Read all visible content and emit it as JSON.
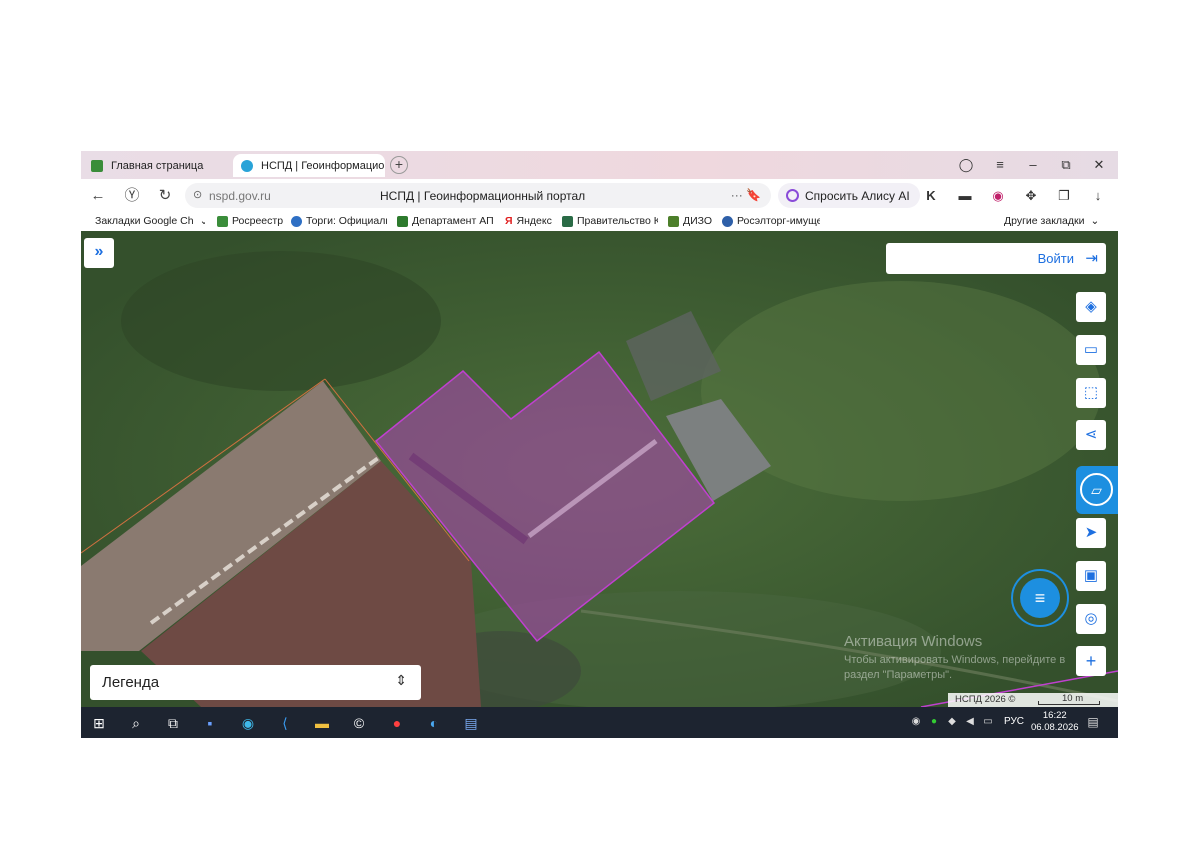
{
  "browser": {
    "tabs": [
      {
        "label": "Главная страница",
        "icon": "gosuslugi-icon",
        "active": false
      },
      {
        "label": "НСПД | Геоинформацио",
        "icon": "nspd-icon",
        "active": true
      }
    ],
    "new_tab": "+",
    "address": "nspd.gov.ru",
    "page_title": "НСПД | Геоинформационный портал",
    "url_more": "··· 🔖",
    "alice_label": "Спросить Алису AI"
  },
  "bookmarks": [
    {
      "label": "Закладки Google Ch",
      "icon": "folder-icon"
    },
    {
      "label": "Росреестр",
      "icon": "rosreestr-icon"
    },
    {
      "label": "Торги: Официальн",
      "icon": "torgi-icon"
    },
    {
      "label": "Департамент АП",
      "icon": "department-icon"
    },
    {
      "label": "Яндекс",
      "icon": "yandex-icon"
    },
    {
      "label": "Правительство К",
      "icon": "government-icon"
    },
    {
      "label": "ДИЗО",
      "icon": "dizo-icon"
    },
    {
      "label": "Росэлторг-имущес",
      "icon": "roseltorg-icon"
    },
    {
      "label": "Другие закладки",
      "icon": "other-bookmarks-icon"
    }
  ],
  "map": {
    "login_label": "Войти",
    "legend_label": "Легенда",
    "parcel_color": "#b043b8",
    "tools": [
      "layers-icon",
      "ruler-icon",
      "select-area-icon",
      "share-icon",
      "print-icon",
      "locate-icon",
      "minimap-icon",
      "geosearch-icon",
      "zoom-in-icon"
    ],
    "watermark_title": "Активация Windows",
    "watermark_text": "Чтобы активировать Windows, перейдите в раздел \"Параметры\".",
    "copyright": "НСПД 2026 ©",
    "scale_label": "10 m"
  },
  "taskbar": {
    "lang": "РУС",
    "time": "16:22",
    "date": "06.08.2026",
    "apps": [
      "start-icon",
      "search-icon",
      "task-view-icon",
      "save-app-icon",
      "edge-icon",
      "app-icon",
      "explorer-icon",
      "ccleaner-icon",
      "yandex-browser-icon",
      "browser-icon",
      "editor-icon"
    ]
  }
}
